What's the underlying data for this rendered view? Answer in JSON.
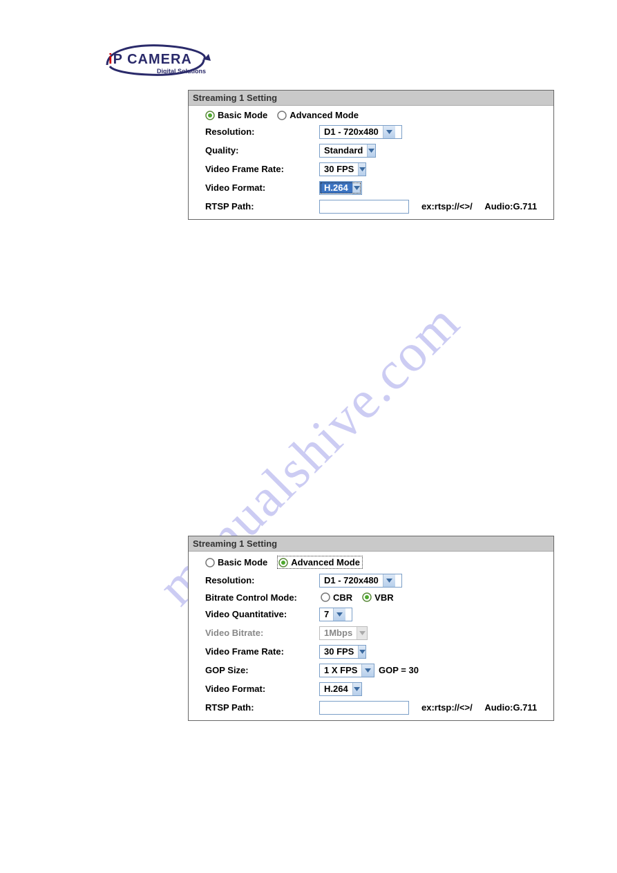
{
  "logo": {
    "brand_prefix": "i",
    "brand_main": "P CAMERA",
    "tagline": "Digital Solutions"
  },
  "watermark": "manualshive.com",
  "panel1": {
    "title": "Streaming 1 Setting",
    "mode_basic": "Basic Mode",
    "mode_advanced": "Advanced Mode",
    "rows": {
      "resolution_label": "Resolution:",
      "resolution_value": "D1 - 720x480",
      "quality_label": "Quality:",
      "quality_value": "Standard",
      "framerate_label": "Video Frame Rate:",
      "framerate_value": "30 FPS",
      "format_label": "Video Format:",
      "format_value": "H.264",
      "rtsp_label": "RTSP Path:",
      "rtsp_value": "",
      "rtsp_hint_ex": "ex:rtsp://<>/",
      "rtsp_hint_audio": "Audio:G.711"
    }
  },
  "panel2": {
    "title": "Streaming 1 Setting",
    "mode_basic": "Basic Mode",
    "mode_advanced": "Advanced Mode",
    "rows": {
      "resolution_label": "Resolution:",
      "resolution_value": "D1 - 720x480",
      "bitrate_mode_label": "Bitrate Control Mode:",
      "bitrate_mode_cbr": "CBR",
      "bitrate_mode_vbr": "VBR",
      "quant_label": "Video Quantitative:",
      "quant_value": "7",
      "bitrate_label": "Video Bitrate:",
      "bitrate_value": "1Mbps",
      "framerate_label": "Video Frame Rate:",
      "framerate_value": "30 FPS",
      "gop_label": "GOP Size:",
      "gop_value": "1 X FPS",
      "gop_note": "GOP = 30",
      "format_label": "Video Format:",
      "format_value": "H.264",
      "rtsp_label": "RTSP Path:",
      "rtsp_value": "",
      "rtsp_hint_ex": "ex:rtsp://<>/",
      "rtsp_hint_audio": "Audio:G.711"
    }
  }
}
